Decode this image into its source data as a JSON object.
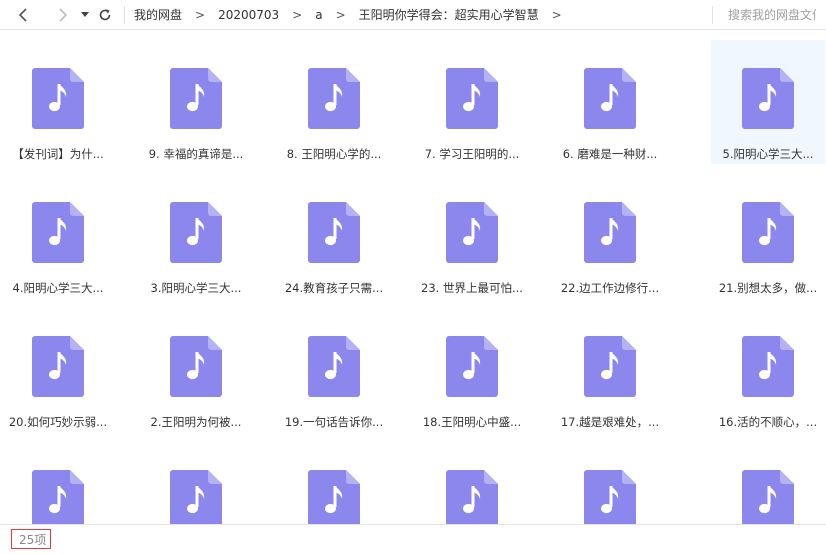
{
  "toolbar": {
    "back_icon": "chevron-left-icon",
    "forward_icon": "chevron-right-icon",
    "dropdown_icon": "caret-down-icon",
    "refresh_icon": "refresh-icon",
    "breadcrumb": [
      "我的网盘",
      "20200703",
      "a",
      "王阳明你学得会：超实用心学智慧"
    ],
    "breadcrumb_separator": ">",
    "search_placeholder": "搜索我的网盘文件"
  },
  "files": [
    {
      "name": "【发刊词】为什...",
      "selected": false
    },
    {
      "name": "9. 幸福的真谛是...",
      "selected": false
    },
    {
      "name": "8. 王阳明心学的...",
      "selected": false
    },
    {
      "name": "7. 学习王阳明的...",
      "selected": false
    },
    {
      "name": "6. 磨难是一种财...",
      "selected": false
    },
    {
      "name": "5.阳明心学三大...",
      "selected": true
    },
    {
      "name": "4.阳明心学三大...",
      "selected": false
    },
    {
      "name": "3.阳明心学三大...",
      "selected": false
    },
    {
      "name": "24.教育孩子只需...",
      "selected": false
    },
    {
      "name": "23. 世界上最可怕...",
      "selected": false
    },
    {
      "name": "22.边工作边修行...",
      "selected": false
    },
    {
      "name": "21.别想太多，做...",
      "selected": false
    },
    {
      "name": "20.如何巧妙示弱...",
      "selected": false
    },
    {
      "name": "2.王阳明为何被...",
      "selected": false
    },
    {
      "name": "19.一句话告诉你...",
      "selected": false
    },
    {
      "name": "18.王阳明心中盛...",
      "selected": false
    },
    {
      "name": "17.越是艰难处，...",
      "selected": false
    },
    {
      "name": "16.活的不顺心，...",
      "selected": false
    },
    {
      "name": "",
      "selected": false
    },
    {
      "name": "",
      "selected": false
    },
    {
      "name": "",
      "selected": false
    },
    {
      "name": "",
      "selected": false
    },
    {
      "name": "",
      "selected": false
    },
    {
      "name": "",
      "selected": false
    }
  ],
  "file_icon": "music-file-icon",
  "colors": {
    "icon_fill": "#8b87ec",
    "icon_fold": "#b4b1f5",
    "selected_bg": "#f1f7fe",
    "count_border": "#e23b3b"
  },
  "status": {
    "count": "25项"
  }
}
